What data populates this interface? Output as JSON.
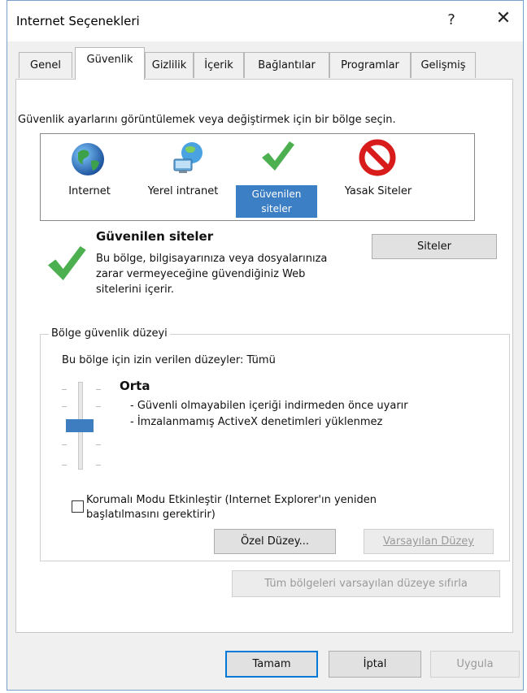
{
  "window": {
    "title": "Internet Seçenekleri",
    "help_glyph": "?",
    "close_glyph": "✕"
  },
  "tabs": [
    {
      "label": "Genel"
    },
    {
      "label": "Güvenlik"
    },
    {
      "label": "Gizlilik"
    },
    {
      "label": "İçerik"
    },
    {
      "label": "Bağlantılar"
    },
    {
      "label": "Programlar"
    },
    {
      "label": "Gelişmiş"
    }
  ],
  "active_tab": "Güvenlik",
  "security": {
    "instruction": "Güvenlik ayarlarını görüntülemek veya değiştirmek için bir bölge seçin.",
    "zones": [
      {
        "label": "Internet",
        "icon": "globe-icon"
      },
      {
        "label": "Yerel intranet",
        "icon": "network-icon"
      },
      {
        "label_line1": "Güvenilen",
        "label_line2": "siteler",
        "icon": "checkmark-icon",
        "selected": true
      },
      {
        "label": "Yasak Siteler",
        "icon": "prohibited-icon"
      }
    ],
    "selected_zone": {
      "title": "Güvenilen siteler",
      "description": "Bu bölge, bilgisayarınıza veya dosyalarınıza zarar vermeyeceğine güvendiğiniz Web sitelerini içerir.",
      "sites_button": "Siteler"
    },
    "level_group": {
      "legend": "Bölge güvenlik düzeyi",
      "allowed_levels": "Bu bölge için izin verilen düzeyler: Tümü",
      "level_name": "Orta",
      "level_lines": [
        "- Güvenli olmayabilen içeriği indirmeden önce uyarır",
        "- İmzalanmamış ActiveX denetimleri yüklenmez"
      ],
      "protected_mode_label": "Korumalı Modu Etkinleştir (Internet Explorer'ın yeniden başlatılmasını gerektirir)",
      "protected_mode_checked": false,
      "custom_level_button": "Özel Düzey...",
      "default_level_button": "Varsayılan Düzey"
    },
    "reset_all_button": "Tüm bölgeleri varsayılan düzeye sıfırla"
  },
  "footer": {
    "ok": "Tamam",
    "cancel": "İptal",
    "apply": "Uygula"
  },
  "colors": {
    "selection_blue": "#3d7fc4",
    "check_green": "#4caf50",
    "prohibited_red": "#d81b1b",
    "slider_blue": "#3f7dc1"
  }
}
